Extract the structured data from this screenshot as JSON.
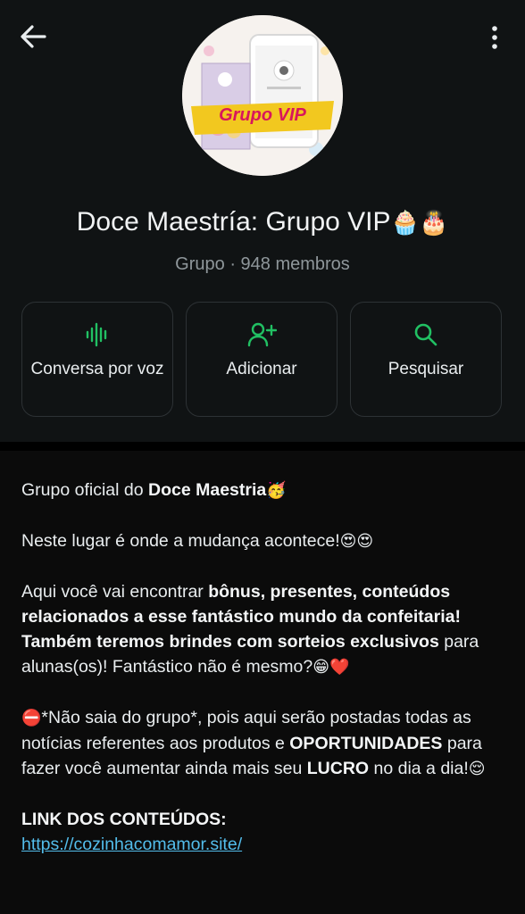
{
  "header": {
    "back_icon": "arrow-left-icon",
    "menu_icon": "more-vertical-icon",
    "avatar": {
      "badge_text": "Grupo VIP"
    },
    "group_name": "Doce Maestría: Grupo VIP",
    "group_name_emoji": "🧁🎂",
    "subtitle": "Grupo · 948 membros"
  },
  "actions": [
    {
      "icon": "voice-wave-icon",
      "label": "Conversa por voz"
    },
    {
      "icon": "add-person-icon",
      "label": "Adicionar"
    },
    {
      "icon": "search-icon",
      "label": "Pesquisar"
    }
  ],
  "description": {
    "p1": {
      "text": "Grupo oficial do ",
      "bold": "Doce Maestria",
      "emoji": "🥳"
    },
    "p2": {
      "text": "Neste lugar é onde a mudança acontece!",
      "emoji": "😍😍"
    },
    "p3": {
      "t1": "Aqui você vai encontrar ",
      "b1": "bônus, presentes, conteúdos relacionados a esse fantástico mundo da confeitaria! Também teremos brindes com sorteios exclusivos",
      "t2": " para alunas(os)! Fantástico não é mesmo?",
      "emoji": "😁❤️"
    },
    "p4": {
      "emoji": "⛔",
      "t1": "*Não saia do grupo*, pois aqui serão postadas todas as notícias referentes aos produtos e ",
      "b1": "OPORTUNIDADES",
      "t2": " para fazer você aumentar ainda mais seu ",
      "b2": "LUCRO",
      "t3": " no dia a dia!",
      "emoji2": "😌"
    },
    "p5": {
      "heading": "LINK DOS CONTEÚDOS:",
      "link": "https://cozinhacomamor.site/"
    }
  },
  "colors": {
    "accent": "#21c063",
    "link": "#53bdeb",
    "background": "#0b0b0b",
    "header_bg": "#101314",
    "badge": "#f2c81f"
  }
}
